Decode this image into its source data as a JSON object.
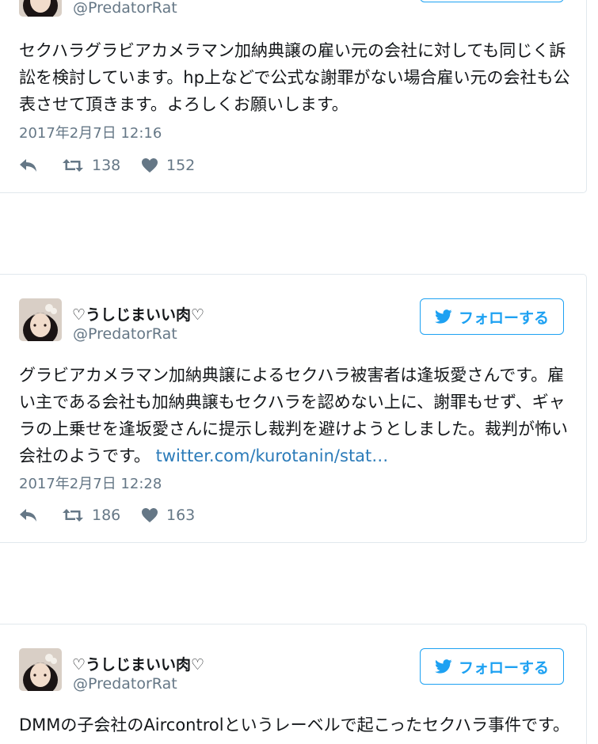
{
  "user": {
    "display_name": "♡うしじまいい肉♡",
    "handle": "@PredatorRat",
    "follow_label": "フォローする"
  },
  "tweets": [
    {
      "text": "セクハラグラビアカメラマン加納典譲の雇い元の会社に対しても同じく訴訟を検討しています。hp上などで公式な謝罪がない場合雇い元の会社も公表させて頂きます。よろしくお願いします。",
      "link": "",
      "timestamp": "2017年2月7日 12:16",
      "retweets": "138",
      "likes": "152"
    },
    {
      "text": "グラビアカメラマン加納典譲によるセクハラ被害者は逢坂愛さんです。雇い主である会社も加納典譲もセクハラを認めない上に、謝罪もせず、ギャラの上乗せを逢坂愛さんに提示し裁判を避けようとしました。裁判が怖い会社のようです。",
      "link": "twitter.com/kurotanin/stat…",
      "timestamp": "2017年2月7日 12:28",
      "retweets": "186",
      "likes": "163"
    },
    {
      "text": "DMMの子会社のAircontrolというレーベルで起こったセクハラ事件です。",
      "link": "",
      "timestamp": "",
      "retweets": "",
      "likes": ""
    }
  ],
  "icons": {
    "reply": "reply-icon",
    "retweet": "retweet-icon",
    "like": "heart-icon",
    "follow": "twitter-bird-icon"
  },
  "colors": {
    "accent": "#1da1f2",
    "link": "#2b7bb9",
    "secondary_text": "#657786",
    "border": "#e1e8ed"
  }
}
